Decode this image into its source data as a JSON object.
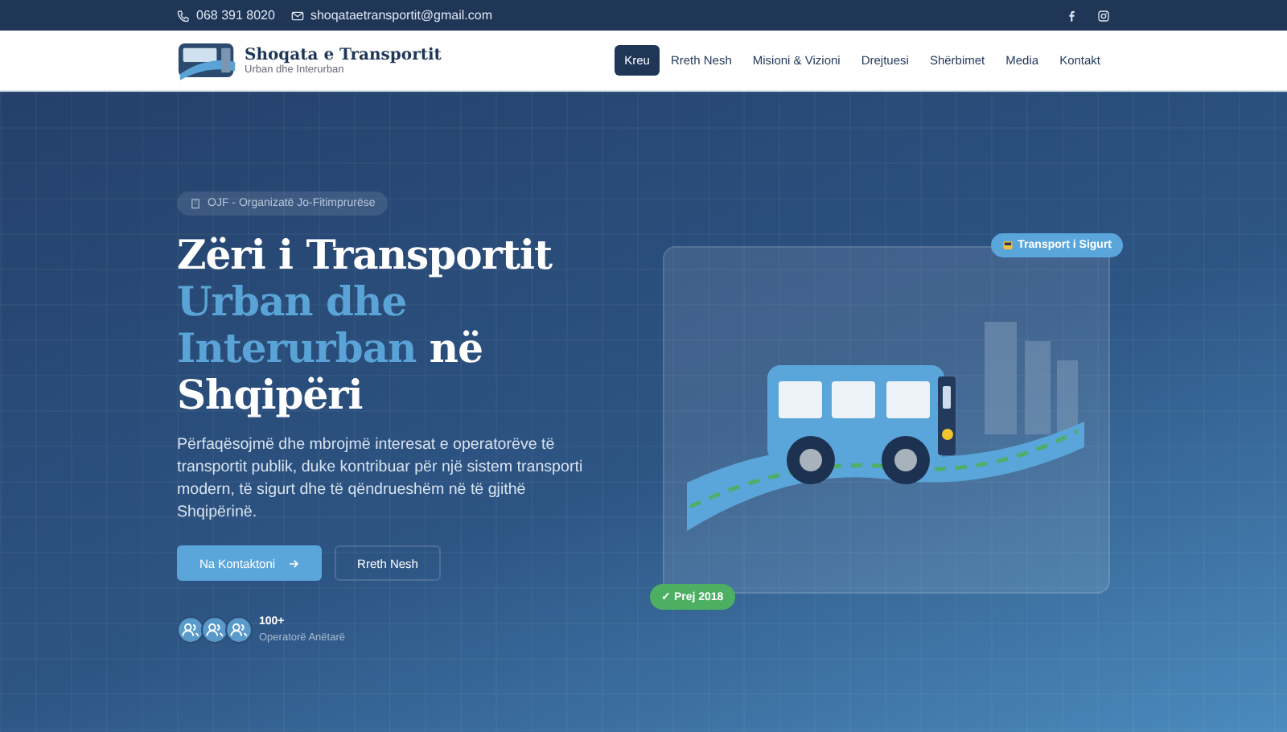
{
  "topbar": {
    "phone": "068 391 8020",
    "email": "shoqataetransportit@gmail.com"
  },
  "header": {
    "brand": "Shoqata e Transportit",
    "tagline": "Urban dhe Interurban",
    "nav": [
      {
        "label": "Kreu",
        "selected": true
      },
      {
        "label": "Rreth Nesh",
        "selected": false
      },
      {
        "label": "Misioni & Vizioni",
        "selected": false
      },
      {
        "label": "Drejtuesi",
        "selected": false
      },
      {
        "label": "Shërbimet",
        "selected": false
      },
      {
        "label": "Media",
        "selected": false
      },
      {
        "label": "Kontakt",
        "selected": false
      }
    ]
  },
  "hero": {
    "badge": "OJF - Organizatë Jo-Fitimprurëse",
    "title": [
      {
        "text": "Zëri i Transportit",
        "kind": "plain"
      },
      {
        "text": "Urban dhe Interurban",
        "kind": "accent"
      },
      {
        "text": "në Shqipëri",
        "kind": "plain"
      }
    ],
    "description": "Përfaqësojmë dhe mbrojmë interesat e operatorëve të transportit publik, duke kontribuar për një sistem transporti modern, të sigurt dhe të qëndrueshëm në të gjithë Shqipërinë.",
    "buttons": [
      {
        "label": "Na Kontaktoni",
        "kind": "primary"
      },
      {
        "label": "Rreth Nesh",
        "kind": "outline"
      }
    ],
    "stat": {
      "value": "100+",
      "label": "Operatorë Anëtarë"
    },
    "card_badges": [
      {
        "text": "Transport i Sigurt",
        "kind": "top"
      },
      {
        "text": "✓ Prej 2018",
        "kind": "bottom"
      }
    ]
  }
}
